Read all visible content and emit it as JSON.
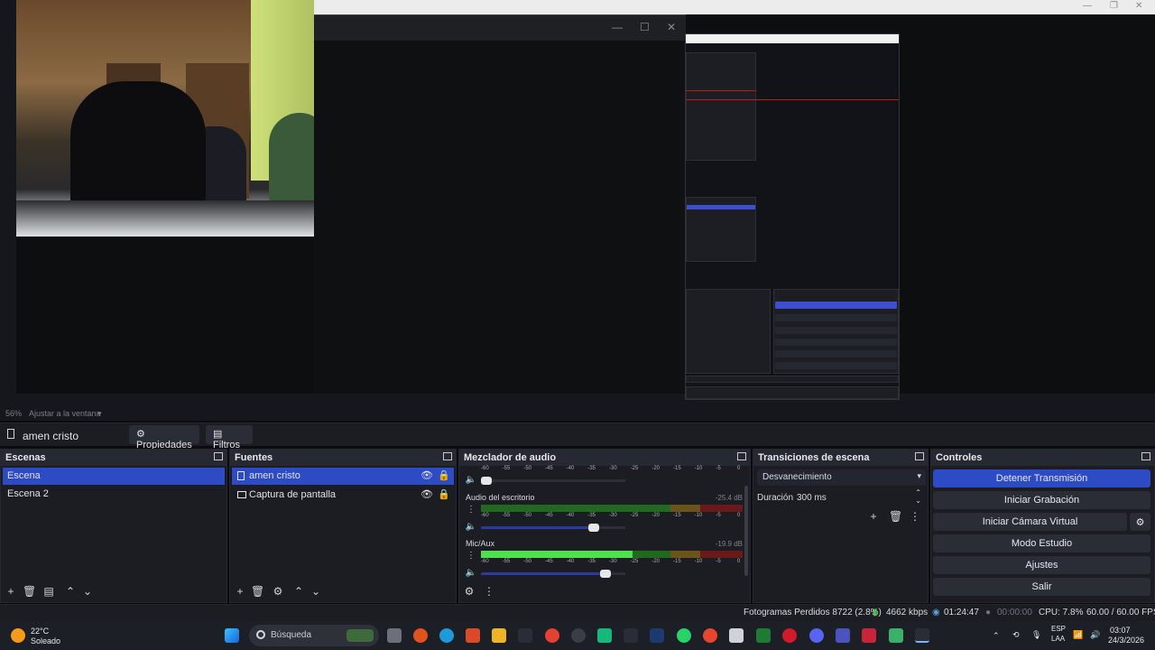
{
  "preview": {
    "zoom_label": "56%",
    "fit_label": "Ajustar a la ventana"
  },
  "context": {
    "current_scene": "amen cristo",
    "properties_label": "Propiedades",
    "filters_label": "Filtros"
  },
  "scenes": {
    "title": "Escenas",
    "items": [
      {
        "label": "Escena",
        "selected": true
      },
      {
        "label": "Escena 2",
        "selected": false
      }
    ]
  },
  "sources": {
    "title": "Fuentes",
    "items": [
      {
        "label": "amen cristo",
        "selected": true
      },
      {
        "label": "Captura de pantalla",
        "selected": false
      }
    ]
  },
  "mixer": {
    "title": "Mezclador de audio",
    "ticks": [
      "-60",
      "-55",
      "-50",
      "-45",
      "-40",
      "-35",
      "-30",
      "-25",
      "-20",
      "-15",
      "-10",
      "-5",
      "0"
    ],
    "channels": [
      {
        "name": "Audio del escritorio",
        "db": "-25.4 dB",
        "level": 0.0,
        "volume": 0.78
      },
      {
        "name": "Mic/Aux",
        "db": "-19.9 dB",
        "level": 0.58,
        "volume": 0.86
      }
    ]
  },
  "transitions": {
    "title": "Transiciones de escena",
    "selected": "Desvanecimiento",
    "duration_label": "Duración",
    "duration_value": "300 ms"
  },
  "controls": {
    "title": "Controles",
    "stop_stream": "Detener Transmisión",
    "start_recording": "Iniciar Grabación",
    "start_virtual_cam": "Iniciar Cámara Virtual",
    "studio_mode": "Modo Estudio",
    "settings": "Ajustes",
    "exit": "Salir"
  },
  "status": {
    "dropped_frames": "Fotogramas Perdidos 8722 (2.8%)",
    "bitrate": "4662 kbps",
    "stream_time": "01:24:47",
    "rec_time": "00:00:00",
    "cpu": "CPU: 7.8%",
    "fps": "60.00 / 60.00 FPS"
  },
  "taskbar": {
    "temperature": "22°C",
    "weather": "Soleado",
    "search_placeholder": "Búsqueda",
    "lang": "ESP",
    "layout": "LAA",
    "time": "03:07",
    "date": "24/3/2026"
  },
  "colors": {
    "accent": "#2e4bc6",
    "panel": "#1b1d23",
    "meter_green": "#4fe04f"
  }
}
